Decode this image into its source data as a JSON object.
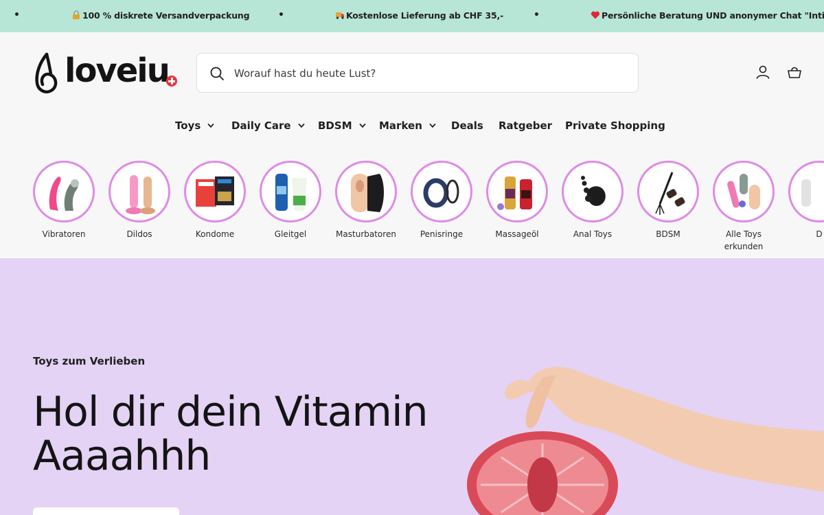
{
  "announcement": {
    "bullet": "•",
    "messages": [
      {
        "icon": "lock-icon",
        "text": "100 % diskrete Versandverpackung"
      },
      {
        "icon": "truck-icon",
        "text": "Kostenlose Lieferung ab CHF 35,-"
      },
      {
        "icon": "heart-icon",
        "text": "Persönliche Beratung UND anonymer Chat \"Intimini\""
      }
    ],
    "background": "#b8e6d6"
  },
  "header": {
    "logo_text": "loveiu",
    "search_placeholder": "Worauf hast du heute Lust?",
    "account_icon": "user-icon",
    "cart_icon": "cart-icon"
  },
  "nav": {
    "items": [
      {
        "label": "Toys",
        "has_dropdown": true
      },
      {
        "label": "Daily Care",
        "has_dropdown": true
      },
      {
        "label": "BDSM",
        "has_dropdown": true
      },
      {
        "label": "Marken",
        "has_dropdown": true
      },
      {
        "label": "Deals",
        "has_dropdown": false
      },
      {
        "label": "Ratgeber",
        "has_dropdown": false
      },
      {
        "label": "Private Shopping",
        "has_dropdown": false
      }
    ]
  },
  "categories": [
    {
      "label": "Vibratoren",
      "icon": "vibrator-icon"
    },
    {
      "label": "Dildos",
      "icon": "dildo-icon"
    },
    {
      "label": "Kondome",
      "icon": "condom-icon"
    },
    {
      "label": "Gleitgel",
      "icon": "lube-icon"
    },
    {
      "label": "Masturbatoren",
      "icon": "masturbator-icon"
    },
    {
      "label": "Penisringe",
      "icon": "penis-ring-icon"
    },
    {
      "label": "Massageöl",
      "icon": "massage-oil-icon"
    },
    {
      "label": "Anal Toys",
      "icon": "anal-toy-icon"
    },
    {
      "label": "BDSM",
      "icon": "bdsm-icon"
    },
    {
      "label": "Alle Toys erkunden",
      "icon": "all-toys-icon"
    },
    {
      "label": "D",
      "icon": "more-icon"
    }
  ],
  "hero": {
    "eyebrow": "Toys zum Verlieben",
    "title": "Hol dir dein Vitamin Aaaahhh",
    "background": "#e4d3f5"
  },
  "colors": {
    "accent_ring": "#de8be6",
    "logo_cross": "#e8323e"
  }
}
